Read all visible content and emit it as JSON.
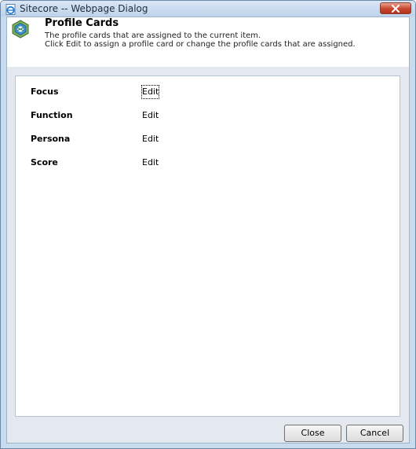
{
  "window": {
    "title": "Sitecore -- Webpage Dialog",
    "icon": "ie-page-icon",
    "close_icon": "close-x-icon"
  },
  "header": {
    "icon": "profile-cards-icon",
    "title": "Profile Cards",
    "description_line1": "The profile cards that are assigned to the current item.",
    "description_line2": "Click Edit to assign a profile card or change the profile cards that are assigned."
  },
  "profiles": [
    {
      "label": "Focus",
      "action": "Edit"
    },
    {
      "label": "Function",
      "action": "Edit"
    },
    {
      "label": "Persona",
      "action": "Edit"
    },
    {
      "label": "Score",
      "action": "Edit"
    }
  ],
  "buttons": {
    "close": "Close",
    "cancel": "Cancel"
  },
  "colors": {
    "titlebar": "#c9dcee",
    "close_button": "#c8462d",
    "body_background": "#e4e9ef"
  }
}
